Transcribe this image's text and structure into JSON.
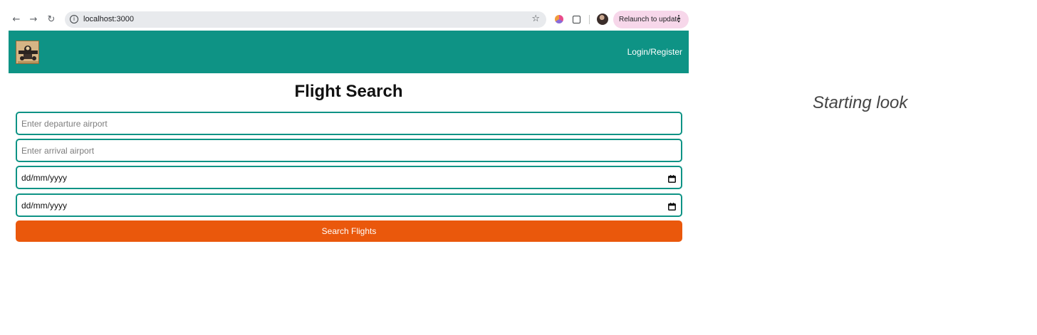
{
  "browser": {
    "url": "localhost:3000",
    "relaunch_label": "Relaunch to update",
    "more_glyph": "⋮",
    "icons": [
      "back-arrow-icon",
      "forward-arrow-icon",
      "reload-icon",
      "info-icon",
      "bookmark-star-icon",
      "extension-icon",
      "puzzle-icon",
      "profile-avatar-icon",
      "more-vert-icon"
    ]
  },
  "app": {
    "brand_color": "#0e9385",
    "accent_color": "#ea580c",
    "logo_icon": "aviator-logo-icon",
    "login_label": "Login/Register"
  },
  "form": {
    "title": "Flight Search",
    "departure_placeholder": "Enter departure airport",
    "arrival_placeholder": "Enter arrival airport",
    "departure_date": "dd/mm/yyyy",
    "return_date": "dd/mm/yyyy",
    "calendar_icon": "calendar-icon",
    "search_label": "Search Flights"
  },
  "caption": {
    "text": "Starting look"
  }
}
